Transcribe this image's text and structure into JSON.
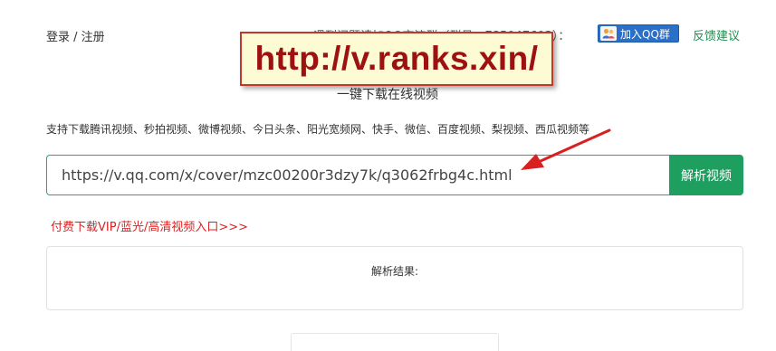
{
  "header": {
    "login_label": "登录 / 注册",
    "group_notice": "遇到问题请加QQ交流群（群号：785047603）：",
    "qq_button_label": "加入QQ群",
    "feedback_label": "反馈建议"
  },
  "watermark": {
    "text": "http://v.ranks.xin/"
  },
  "main": {
    "subtitle": "一键下载在线视频",
    "supported_sites": "支持下载腾讯视频、秒拍视频、微博视频、今日头条、阳光宽频网、快手、微信、百度视频、梨视频、西瓜视频等",
    "url_input_value": "https://v.qq.com/x/cover/mzc00200r3dzy7k/q3062frbg4c.html",
    "parse_button_label": "解析视频",
    "vip_link_label": "付费下载VIP/蓝光/高清视频入口>>>"
  },
  "result": {
    "label": "解析结果:"
  },
  "colors": {
    "accent_green": "#1e9e5f",
    "link_green": "#1a8f4e",
    "vip_red": "#e02020",
    "watermark_red": "#9e1111",
    "arrow_red": "#d92020",
    "qq_blue": "#2a70c8"
  },
  "icons": {
    "qq": "qq-people-icon",
    "annotation": "red-arrow-icon"
  }
}
